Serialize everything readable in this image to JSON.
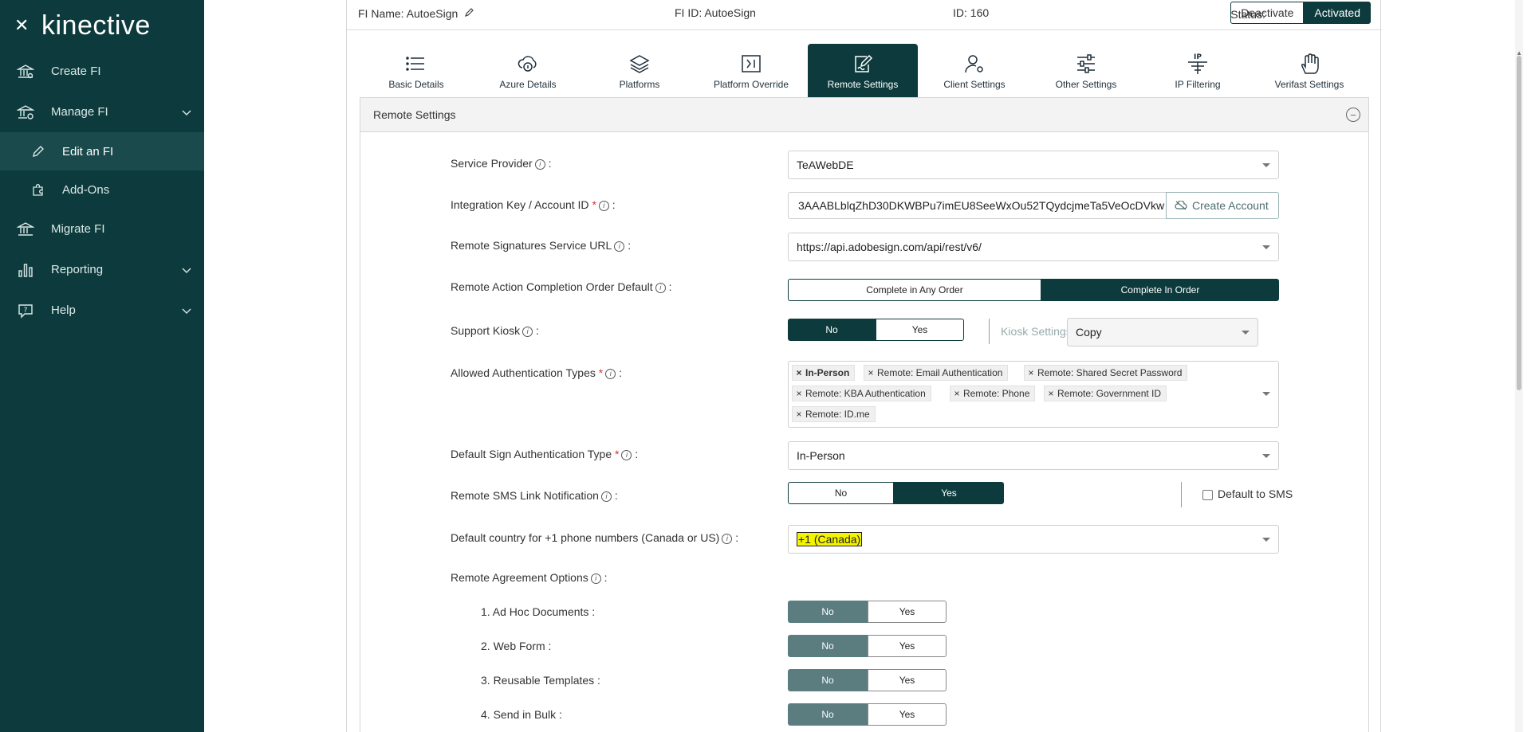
{
  "sidebar": {
    "logo": "kinective",
    "items": [
      {
        "label": "Create FI"
      },
      {
        "label": "Manage FI"
      },
      {
        "label": "Edit an FI"
      },
      {
        "label": "Add-Ons"
      },
      {
        "label": "Migrate FI"
      },
      {
        "label": "Reporting"
      },
      {
        "label": "Help"
      }
    ]
  },
  "infobar": {
    "fi_name": "FI Name: AutoeSign",
    "fi_id": "FI ID: AutoeSign",
    "id": "ID: 160",
    "status_label": "Status:",
    "deactivate": "Deactivate",
    "activated": "Activated"
  },
  "tabs": [
    {
      "label": "Basic Details",
      "icon": "list-icon"
    },
    {
      "label": "Azure Details",
      "icon": "cloud-icon"
    },
    {
      "label": "Platforms",
      "icon": "layers-icon"
    },
    {
      "label": "Platform Override",
      "icon": "override-icon"
    },
    {
      "label": "Remote Settings",
      "icon": "remote-edit-icon"
    },
    {
      "label": "Client Settings",
      "icon": "user-gear-icon"
    },
    {
      "label": "Other Settings",
      "icon": "sliders-icon"
    },
    {
      "label": "IP Filtering",
      "icon": "ip-filter-icon"
    },
    {
      "label": "Verifast Settings",
      "icon": "hand-icon"
    }
  ],
  "section": {
    "title": "Remote Settings"
  },
  "form": {
    "service_provider": {
      "label": "Service Provider",
      "value": "TeAWebDE"
    },
    "integration_key": {
      "label": "Integration Key / Account ID",
      "value": "3AAABLblqZhD30DKWBPu7imEU8SeeWxOu52TQydcjmeTa5VeOcDVkw",
      "button": "Create Account"
    },
    "service_url": {
      "label": "Remote Signatures Service URL",
      "value": "https://api.adobesign.com/api/rest/v6/"
    },
    "completion_order": {
      "label": "Remote Action Completion Order Default",
      "option_any": "Complete in Any Order",
      "option_order": "Complete In Order"
    },
    "support_kiosk": {
      "label": "Support Kiosk",
      "no": "No",
      "yes": "Yes",
      "kiosk_label": "Kiosk Settings:",
      "kiosk_value": "Copy"
    },
    "auth_types": {
      "label": "Allowed Authentication Types",
      "tags": [
        "In-Person",
        "Remote: Email Authentication",
        "Remote: Shared Secret Password",
        "Remote: KBA Authentication",
        "Remote: Phone",
        "Remote: Government ID",
        "Remote: ID.me"
      ]
    },
    "default_sign_auth": {
      "label": "Default Sign Authentication Type",
      "value": "In-Person"
    },
    "sms_link": {
      "label": "Remote SMS Link Notification",
      "no": "No",
      "yes": "Yes",
      "default_sms": "Default to SMS"
    },
    "default_country": {
      "label": "Default country for +1 phone numbers (Canada or US)",
      "value": "+1 (Canada)"
    },
    "agreement_options": {
      "label": "Remote Agreement Options"
    },
    "options": [
      {
        "label": "1. Ad Hoc Documents :",
        "no": "No",
        "yes": "Yes"
      },
      {
        "label": "2. Web Form :",
        "no": "No",
        "yes": "Yes"
      },
      {
        "label": "3. Reusable Templates :",
        "no": "No",
        "yes": "Yes"
      },
      {
        "label": "4. Send in Bulk :",
        "no": "No",
        "yes": "Yes"
      }
    ]
  }
}
